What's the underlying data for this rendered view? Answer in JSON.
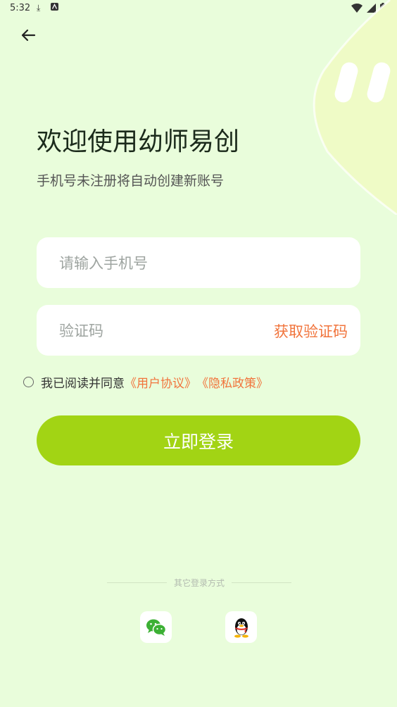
{
  "status_bar": {
    "time": "5:32"
  },
  "title": "欢迎使用幼师易创",
  "subtitle": "手机号未注册将自动创建新账号",
  "phone_input": {
    "placeholder": "请输入手机号",
    "value": ""
  },
  "code_input": {
    "placeholder": "验证码",
    "value": ""
  },
  "get_code_label": "获取验证码",
  "agreement": {
    "prefix": "我已阅读并同意",
    "user_agreement": "《用户协议》",
    "privacy_policy": "《隐私政策》"
  },
  "login_button": "立即登录",
  "other_login_label": "其它登录方式",
  "colors": {
    "background": "#e9fddb",
    "accent": "#a2d414",
    "link": "#f1743c"
  },
  "icons": [
    "back-arrow-icon",
    "wechat-icon",
    "qq-icon"
  ]
}
